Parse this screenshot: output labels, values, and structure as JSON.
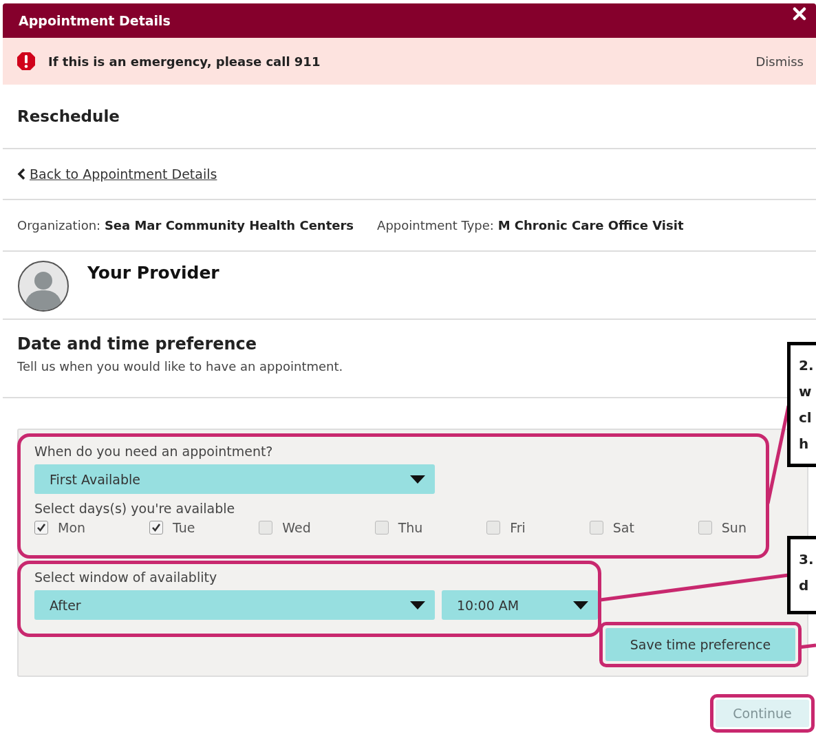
{
  "header": {
    "title": "Appointment Details"
  },
  "alert": {
    "message": "If this is an emergency, please call 911",
    "dismiss": "Dismiss"
  },
  "section_title": "Reschedule",
  "back_link": "Back to Appointment Details",
  "details": [
    {
      "label": "Organization:",
      "value": "Sea Mar Community Health Centers"
    },
    {
      "label": "Appointment Type:",
      "value": "M Chronic Care Office Visit"
    }
  ],
  "provider": {
    "heading": "Your Provider"
  },
  "preference": {
    "heading": "Date and time preference",
    "description": "Tell us when you would like to have an appointment."
  },
  "form": {
    "need_label": "When do you need an appointment?",
    "need_value": "First Available",
    "days_label": "Select days(s) you're available",
    "days": [
      {
        "label": "Mon",
        "checked": true
      },
      {
        "label": "Tue",
        "checked": true
      },
      {
        "label": "Wed",
        "checked": false
      },
      {
        "label": "Thu",
        "checked": false
      },
      {
        "label": "Fri",
        "checked": false
      },
      {
        "label": "Sat",
        "checked": false
      },
      {
        "label": "Sun",
        "checked": false
      }
    ],
    "window_label": "Select window of availablity",
    "window_value": "After",
    "time_value": "10:00 AM",
    "save_button": "Save time preference"
  },
  "continue_button": {
    "label": "Continue",
    "disabled": true
  },
  "callouts": [
    {
      "lines": [
        "2.",
        "w",
        "cl",
        "h"
      ]
    },
    {
      "lines": [
        "3.",
        "d"
      ]
    }
  ]
}
